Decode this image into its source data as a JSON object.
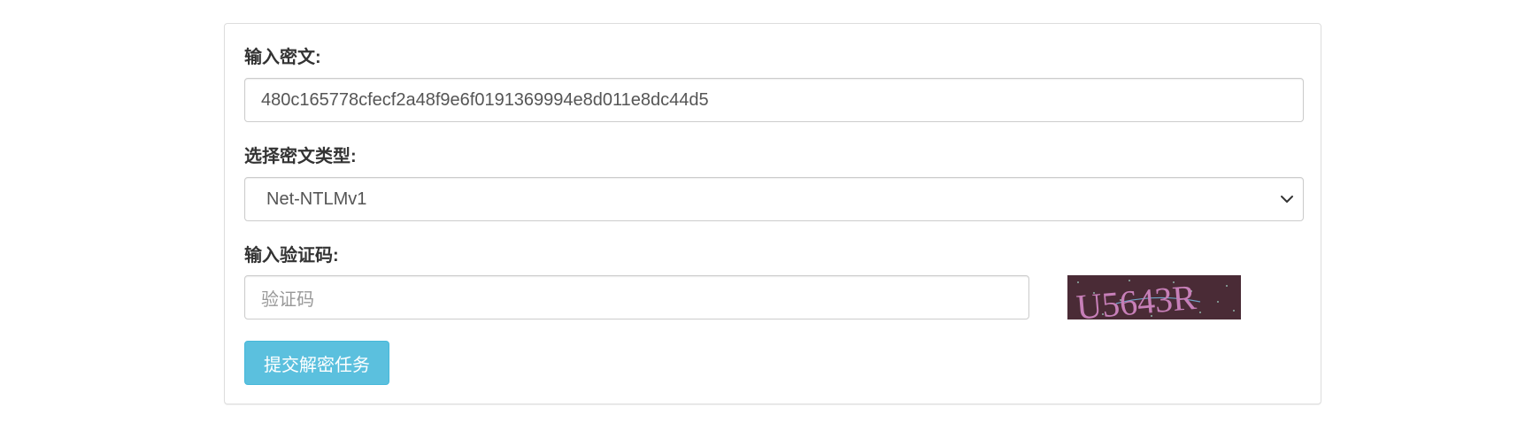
{
  "form": {
    "ciphertext_label": "输入密文:",
    "ciphertext_value": "480c165778cfecf2a48f9e6f0191369994e8d011e8dc44d5",
    "type_label": "选择密文类型:",
    "type_selected": "Net-NTLMv1",
    "captcha_label": "输入验证码:",
    "captcha_placeholder": "验证码",
    "captcha_text": "U5643R",
    "submit_label": "提交解密任务"
  },
  "colors": {
    "button_bg": "#5bc0de",
    "captcha_bg": "#4a2b36",
    "captcha_text": "#c77fb8"
  },
  "icons": {
    "select_arrow": "chevron-down-icon"
  }
}
